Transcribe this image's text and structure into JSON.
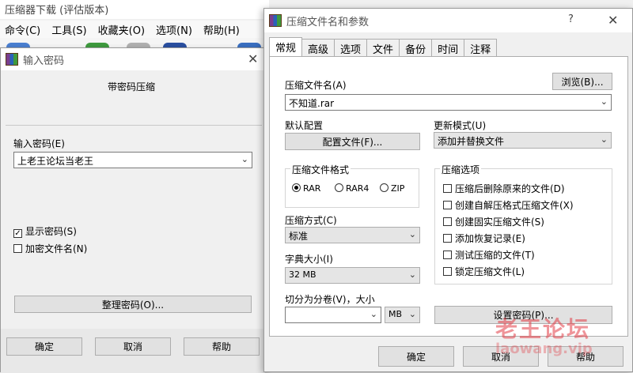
{
  "background_window": {
    "title": "压缩器下载 (评估版本)",
    "menu": [
      "命令(C)",
      "工具(S)",
      "收藏夹(O)",
      "选项(N)",
      "帮助(H)"
    ]
  },
  "password_dialog": {
    "title": "输入密码",
    "heading": "带密码压缩",
    "password_label": "输入密码(E)",
    "password_value": "上老王论坛当老王",
    "show_password": "显示密码(S)",
    "show_password_checked": true,
    "encrypt_names": "加密文件名(N)",
    "encrypt_names_checked": false,
    "organize_button": "整理密码(O)...",
    "ok": "确定",
    "cancel": "取消",
    "help": "帮助"
  },
  "archive_dialog": {
    "title": "压缩文件名和参数",
    "help_glyph": "?",
    "tabs": [
      "常规",
      "高级",
      "选项",
      "文件",
      "备份",
      "时间",
      "注释"
    ],
    "archive_name_label": "压缩文件名(A)",
    "browse_button": "浏览(B)...",
    "archive_name_value": "不知道.rar",
    "default_profile_label": "默认配置",
    "profile_button": "配置文件(F)...",
    "update_mode_label": "更新模式(U)",
    "update_mode_value": "添加并替换文件",
    "format_group": "压缩文件格式",
    "formats": [
      "RAR",
      "RAR4",
      "ZIP"
    ],
    "selected_format": "RAR",
    "method_label": "压缩方式(C)",
    "method_value": "标准",
    "dict_label": "字典大小(I)",
    "dict_value": "32 MB",
    "split_label": "切分为分卷(V)，大小",
    "split_value": "",
    "split_unit": "MB",
    "options_group": "压缩选项",
    "options": [
      {
        "label": "压缩后删除原来的文件(D)",
        "checked": false
      },
      {
        "label": "创建自解压格式压缩文件(X)",
        "checked": false
      },
      {
        "label": "创建固实压缩文件(S)",
        "checked": false
      },
      {
        "label": "添加恢复记录(E)",
        "checked": false
      },
      {
        "label": "测试压缩的文件(T)",
        "checked": false
      },
      {
        "label": "锁定压缩文件(L)",
        "checked": false
      }
    ],
    "set_password_button": "设置密码(P)...",
    "ok": "确定",
    "cancel": "取消",
    "help": "帮助"
  },
  "watermark": {
    "line1": "老王论坛",
    "line2": "laowang.vip"
  },
  "colors": {
    "dialog_bg": "#f0f0f0",
    "button_bg": "#e1e1e1",
    "watermark": "#e23c46"
  }
}
